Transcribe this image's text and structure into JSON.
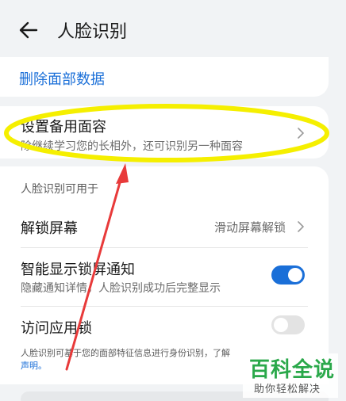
{
  "header": {
    "title": "人脸识别",
    "back_icon": "arrow-left-icon"
  },
  "delete": {
    "label": "删除面部数据"
  },
  "alternate_face": {
    "title": "设置备用面容",
    "description": "除继续学习您的长相外，还可识别另一种面容"
  },
  "usage": {
    "header": "人脸识别可用于",
    "unlock": {
      "label": "解锁屏幕",
      "value": "滑动屏幕解锁"
    },
    "smart_notify": {
      "label": "智能显示锁屏通知",
      "sub": "隐藏通知详情，人脸识别成功后完整显示",
      "enabled": true
    },
    "app_lock": {
      "label": "访问应用锁",
      "enabled": false
    },
    "footnote": "人脸识别可基于您的面部特征信息进行身份识别，了解",
    "footnote_link": "声明。"
  },
  "watermark": {
    "main": "百科全说",
    "sub": "助你轻松解决"
  },
  "colors": {
    "accent": "#1a6fd8",
    "annotation_ellipse": "#f5ef00",
    "annotation_arrow": "#e83a3a",
    "watermark_green": "#2aa84a"
  }
}
